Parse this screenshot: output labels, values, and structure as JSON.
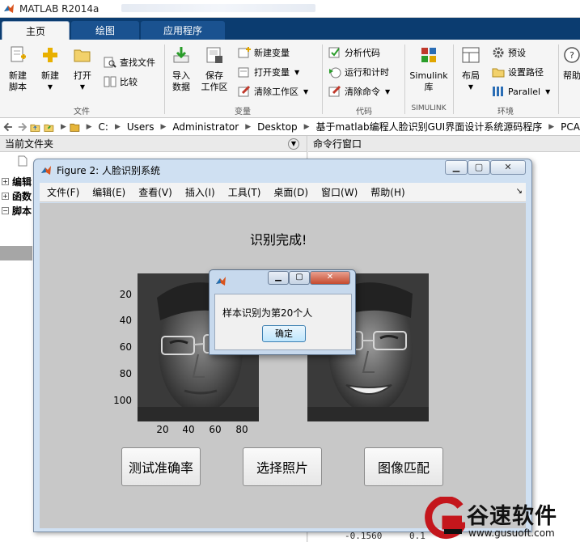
{
  "app": {
    "title": "MATLAB R2014a",
    "tabs": [
      "主页",
      "绘图",
      "应用程序"
    ]
  },
  "ribbon": {
    "file_group": {
      "label": "文件",
      "new_script": "新建\n脚本",
      "new": "新建",
      "open": "打开",
      "find_files": "查找文件",
      "compare": "比较"
    },
    "variable_group": {
      "label": "变量",
      "import_data": "导入\n数据",
      "save_workspace": "保存\n工作区",
      "new_variable": "新建变量",
      "open_variable": "打开变量",
      "clear_workspace": "清除工作区"
    },
    "code_group": {
      "label": "代码",
      "analyze_code": "分析代码",
      "run_and_time": "运行和计时",
      "clear_commands": "清除命令"
    },
    "simulink_group": {
      "label": "SIMULINK",
      "simulink_library": "Simulink\n库"
    },
    "environment_group": {
      "label": "环境",
      "layout": "布局",
      "preferences": "预设",
      "set_path": "设置路径",
      "parallel": "Parallel"
    },
    "help": "帮助"
  },
  "path": {
    "segments": [
      "C:",
      "Users",
      "Administrator",
      "Desktop",
      "基于matlab编程人脸识别GUI界面设计系统源码程序",
      "PCA"
    ]
  },
  "left_panel": {
    "title": "当前文件夹",
    "items": [
      "编辑",
      "函数",
      "脚本"
    ]
  },
  "right_panel": {
    "title": "命令行窗口",
    "visible_numbers": [
      "-0.1560",
      "0.1"
    ]
  },
  "figure": {
    "title": "Figure 2: 人脸识别系统",
    "menu": [
      "文件(F)",
      "编辑(E)",
      "查看(V)",
      "插入(I)",
      "工具(T)",
      "桌面(D)",
      "窗口(W)",
      "帮助(H)"
    ],
    "status_text": "识别完成!",
    "y_ticks": [
      "20",
      "40",
      "60",
      "80",
      "100"
    ],
    "x_ticks": [
      "20",
      "40",
      "60",
      "80"
    ],
    "buttons": {
      "test_accuracy": "测试准确率",
      "select_photo": "选择照片",
      "image_match": "图像匹配"
    }
  },
  "dialog": {
    "message": "样本识别为第20个人",
    "ok": "确定"
  },
  "watermark": {
    "name": "谷速软件",
    "url": "www.gusuoft.com"
  }
}
